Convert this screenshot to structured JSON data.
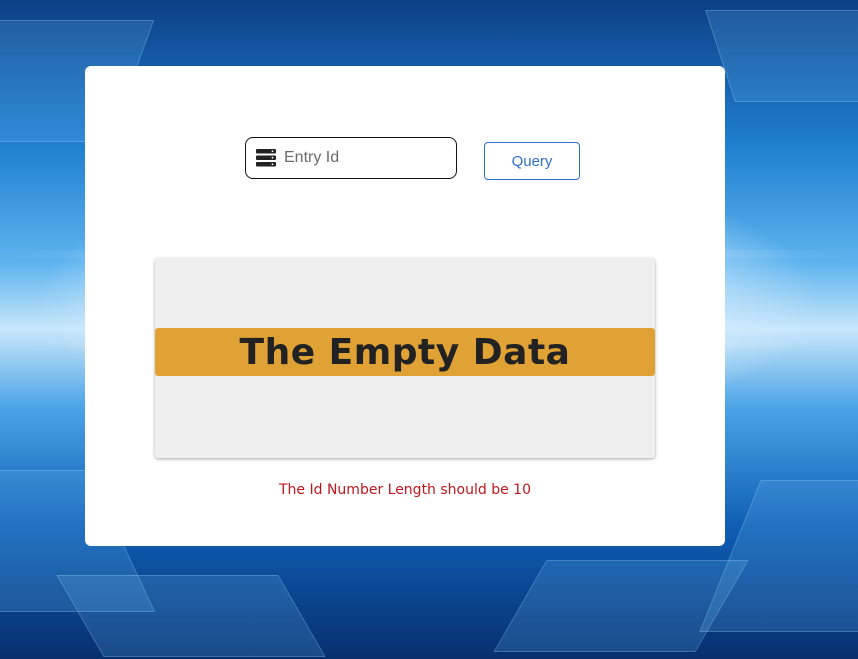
{
  "search": {
    "placeholder": "Entry Id",
    "value": "",
    "icon": "database-icon"
  },
  "query_button": {
    "label": "Query"
  },
  "result": {
    "empty_text": "The Empty Data",
    "banner_color": "#e0a235"
  },
  "validation": {
    "message": "The Id Number Length should be 10",
    "color": "#c0161c"
  },
  "colors": {
    "accent": "#2f6fcf",
    "card": "#ffffff",
    "result_bg": "#efefef"
  }
}
